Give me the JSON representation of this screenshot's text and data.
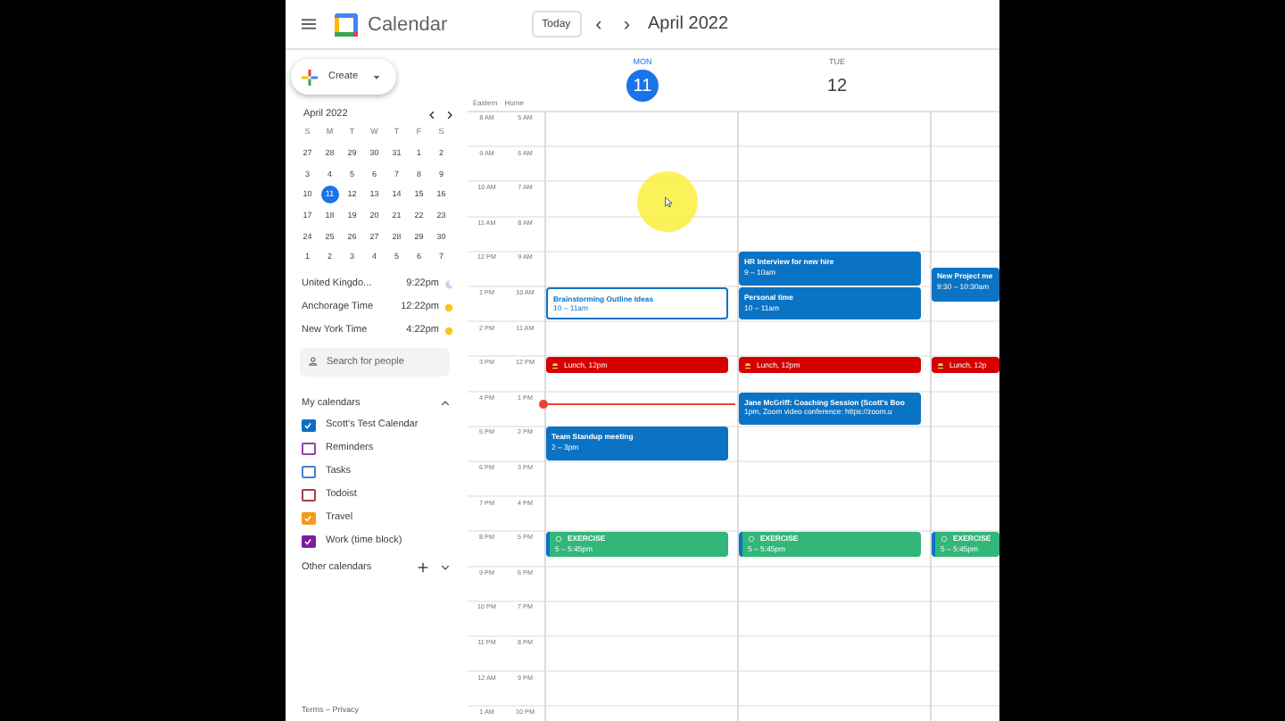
{
  "app": {
    "title": "Calendar"
  },
  "toolbar": {
    "today": "Today",
    "prev": "‹",
    "next": "›",
    "period": "April 2022"
  },
  "create": {
    "label": "Create"
  },
  "mini_calendar": {
    "title": "April 2022",
    "weekdays": [
      "S",
      "M",
      "T",
      "W",
      "T",
      "F",
      "S"
    ],
    "weeks": [
      [
        {
          "day": "27",
          "selected": false
        },
        {
          "day": "28",
          "selected": false
        },
        {
          "day": "29",
          "selected": false
        },
        {
          "day": "30",
          "selected": false
        },
        {
          "day": "31",
          "selected": false
        },
        {
          "day": "1",
          "selected": false
        },
        {
          "day": "2",
          "selected": false
        }
      ],
      [
        {
          "day": "3",
          "selected": false
        },
        {
          "day": "4",
          "selected": false
        },
        {
          "day": "5",
          "selected": false
        },
        {
          "day": "6",
          "selected": false
        },
        {
          "day": "7",
          "selected": false
        },
        {
          "day": "8",
          "selected": false
        },
        {
          "day": "9",
          "selected": false
        }
      ],
      [
        {
          "day": "10",
          "selected": false
        },
        {
          "day": "11",
          "selected": true
        },
        {
          "day": "12",
          "selected": false
        },
        {
          "day": "13",
          "selected": false
        },
        {
          "day": "14",
          "selected": false
        },
        {
          "day": "15",
          "selected": false
        },
        {
          "day": "16",
          "selected": false
        }
      ],
      [
        {
          "day": "17",
          "selected": false
        },
        {
          "day": "18",
          "selected": false
        },
        {
          "day": "19",
          "selected": false
        },
        {
          "day": "20",
          "selected": false
        },
        {
          "day": "21",
          "selected": false
        },
        {
          "day": "22",
          "selected": false
        },
        {
          "day": "23",
          "selected": false
        }
      ],
      [
        {
          "day": "24",
          "selected": false
        },
        {
          "day": "25",
          "selected": false
        },
        {
          "day": "26",
          "selected": false
        },
        {
          "day": "27",
          "selected": false
        },
        {
          "day": "28",
          "selected": false
        },
        {
          "day": "29",
          "selected": false
        },
        {
          "day": "30",
          "selected": false
        }
      ],
      [
        {
          "day": "1",
          "selected": false
        },
        {
          "day": "2",
          "selected": false
        },
        {
          "day": "3",
          "selected": false
        },
        {
          "day": "4",
          "selected": false
        },
        {
          "day": "5",
          "selected": false
        },
        {
          "day": "6",
          "selected": false
        },
        {
          "day": "7",
          "selected": false
        }
      ]
    ]
  },
  "time_zones": [
    {
      "name": "United Kingdo...",
      "time": "9:22pm",
      "kind": "night"
    },
    {
      "name": "Anchorage Time",
      "time": "12:22pm",
      "kind": "day"
    },
    {
      "name": "New York Time",
      "time": "4:22pm",
      "kind": "day"
    }
  ],
  "search": {
    "placeholder": "Search for people"
  },
  "my_calendars": {
    "title": "My calendars",
    "expanded": true,
    "items": [
      {
        "label": "Scott's Test Calendar",
        "checked": true,
        "color": "#0b6fc4"
      },
      {
        "label": "Reminders",
        "checked": false,
        "color": "#8e44ad"
      },
      {
        "label": "Tasks",
        "checked": false,
        "color": "#4a7fd0"
      },
      {
        "label": "Todoist",
        "checked": false,
        "color": "#b03a48"
      },
      {
        "label": "Travel",
        "checked": true,
        "color": "#f29a1a"
      },
      {
        "label": "Work (time block)",
        "checked": true,
        "color": "#7b1fa2"
      }
    ]
  },
  "other_calendars": {
    "title": "Other calendars",
    "expanded": false
  },
  "footer": {
    "text": "Terms – Privacy"
  },
  "days": [
    {
      "weekday": "MON",
      "date": "11",
      "selected": true
    },
    {
      "weekday": "TUE",
      "date": "12",
      "selected": false
    }
  ],
  "timezone_labels": [
    "Eastern",
    "Home"
  ],
  "rows": [
    {
      "eastern": "8 AM",
      "home": "5 AM"
    },
    {
      "eastern": "9 AM",
      "home": "6 AM"
    },
    {
      "eastern": "10 AM",
      "home": "7 AM"
    },
    {
      "eastern": "11 AM",
      "home": "8 AM"
    },
    {
      "eastern": "12 PM",
      "home": "9 AM",
      "tue": [
        {
          "kind": "event",
          "title": "HR Interview for new hire",
          "time": "9 – 10am"
        }
      ],
      "column_3": [
        {
          "kind": "late",
          "title": "New Project me",
          "time": "9:30 – 10:30am"
        }
      ]
    },
    {
      "eastern": "1 PM",
      "home": "10 AM",
      "mon": [
        {
          "kind": "outlined",
          "title": "Brainstorming Outline Ideas",
          "time": "10 – 11am"
        }
      ],
      "tue": [
        {
          "kind": "event",
          "title": "Personal time",
          "time": "10 – 11am"
        }
      ]
    },
    {
      "eastern": "2 PM",
      "home": "11 AM"
    },
    {
      "eastern": "3 PM",
      "home": "12 PM",
      "mon": [
        {
          "kind": "lunch",
          "title": "Lunch, 12pm"
        }
      ],
      "tue": [
        {
          "kind": "lunch",
          "title": "Lunch, 12pm"
        }
      ],
      "column_3": [
        {
          "kind": "lunch",
          "title": "Lunch, 12p"
        }
      ]
    },
    {
      "eastern": "4 PM",
      "home": "1 PM",
      "now_line": true,
      "tue": [
        {
          "kind": "event",
          "title": "Jane McGriff: Coaching Session (Scott's Boo",
          "time": "1pm, Zoom video conference: https://zoom.u"
        }
      ]
    },
    {
      "eastern": "5 PM",
      "home": "2 PM",
      "mon": [
        {
          "kind": "event",
          "title": "Team Standup meeting",
          "time": "2 – 3pm"
        }
      ]
    },
    {
      "eastern": "6 PM",
      "home": "3 PM"
    },
    {
      "eastern": "7 PM",
      "home": "4 PM"
    },
    {
      "eastern": "8 PM",
      "home": "5 PM",
      "mon": [
        {
          "kind": "exercise",
          "title": "EXERCISE",
          "time": "5 – 5:45pm"
        }
      ],
      "tue": [
        {
          "kind": "exercise",
          "title": "EXERCISE",
          "time": "5 – 5:45pm"
        }
      ],
      "column_3": [
        {
          "kind": "exercise",
          "title": "EXERCISE",
          "time": "5 – 5:45pm"
        }
      ]
    },
    {
      "eastern": "9 PM",
      "home": "6 PM"
    },
    {
      "eastern": "10 PM",
      "home": "7 PM"
    },
    {
      "eastern": "11 PM",
      "home": "8 PM"
    },
    {
      "eastern": "12 AM",
      "home": "9 PM"
    },
    {
      "eastern": "1 AM",
      "home": "10 PM"
    }
  ]
}
